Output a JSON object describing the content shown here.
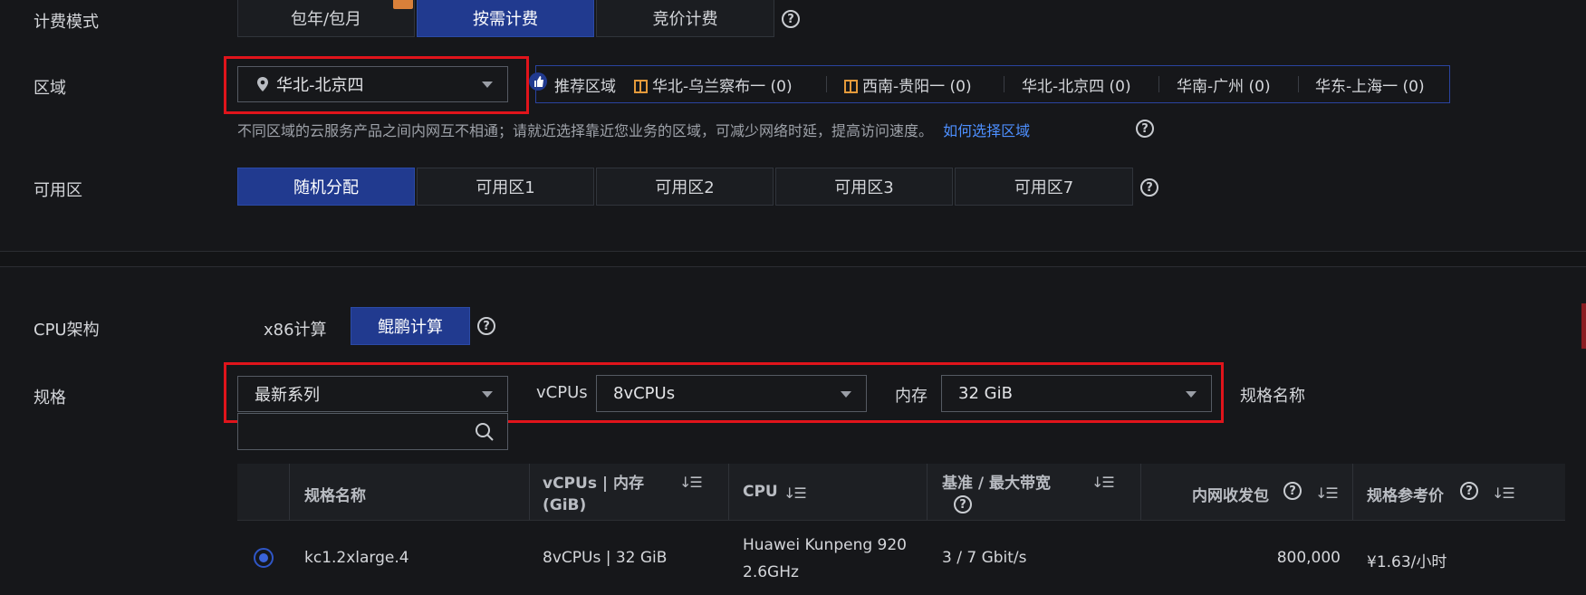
{
  "billing": {
    "label": "计费模式",
    "options": [
      "包年/包月",
      "按需计费",
      "竞价计费"
    ],
    "selected_index": 1
  },
  "region": {
    "label": "区域",
    "selected": "华北-北京四",
    "recommend_label": "推荐区域",
    "recommended": [
      {
        "name": "华北-乌兰察布一 (0)",
        "gift": true
      },
      {
        "name": "西南-贵阳一 (0)",
        "gift": true
      },
      {
        "name": "华北-北京四 (0)",
        "gift": false
      },
      {
        "name": "华南-广州 (0)",
        "gift": false
      },
      {
        "name": "华东-上海一 (0)",
        "gift": false
      }
    ],
    "hint": "不同区域的云服务产品之间内网互不相通；请就近选择靠近您业务的区域，可减少网络时延，提高访问速度。",
    "hint_link": "如何选择区域"
  },
  "az": {
    "label": "可用区",
    "options": [
      "随机分配",
      "可用区1",
      "可用区2",
      "可用区3",
      "可用区7"
    ],
    "selected_index": 0
  },
  "cpu_arch": {
    "label": "CPU架构",
    "options": [
      "x86计算",
      "鲲鹏计算"
    ],
    "selected_index": 1
  },
  "spec": {
    "label": "规格",
    "series_value": "最新系列",
    "vcpus_label": "vCPUs",
    "vcpus_value": "8vCPUs",
    "memory_label": "内存",
    "memory_value": "32 GiB",
    "name_label": "规格名称",
    "search_placeholder": ""
  },
  "table": {
    "headers": {
      "name": "规格名称",
      "vcpu_mem_line1": "vCPUs | 内存",
      "vcpu_mem_line2": "(GiB)",
      "cpu": "CPU",
      "bandwidth": "基准 / 最大带宽",
      "pps": "内网收发包",
      "price": "规格参考价"
    },
    "rows": [
      {
        "name": "kc1.2xlarge.4",
        "vcpu_mem": "8vCPUs | 32 GiB",
        "cpu_line1": "Huawei Kunpeng 920",
        "cpu_line2": "2.6GHz",
        "bandwidth": "3 / 7 Gbit/s",
        "pps": "800,000",
        "price": "¥1.63/小时"
      }
    ]
  },
  "colors": {
    "accent": "#213a8f",
    "highlight": "#e0141b",
    "link": "#4d8fff",
    "gift": "#e49a3b"
  }
}
